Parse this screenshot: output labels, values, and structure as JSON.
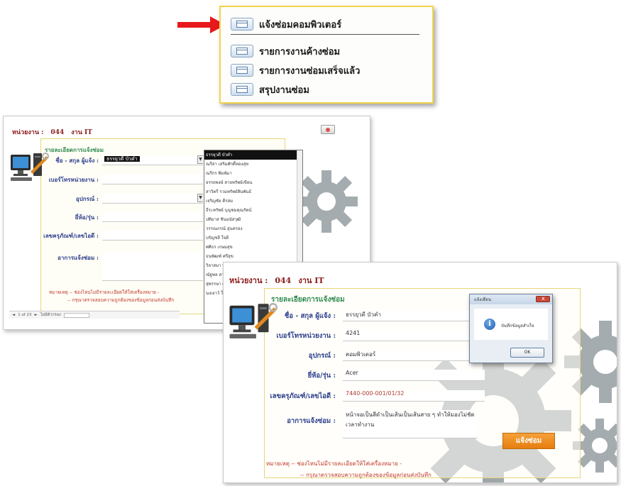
{
  "menu": {
    "items": [
      {
        "label": "แจ้งซ่อมคอมพิวเตอร์",
        "icon": "form-icon"
      },
      {
        "label": "รายการงานค้างซ่อม",
        "icon": "form-icon"
      },
      {
        "label": "รายการงานซ่อมเสร็จแล้ว",
        "icon": "form-icon"
      },
      {
        "label": "สรุปงานซ่อม",
        "icon": "form-icon"
      }
    ],
    "pointer_icon": "red-arrow-icon"
  },
  "form_a": {
    "dept_label": "หน่วยงาน :",
    "dept_code": "044",
    "dept_name": "งาน IT",
    "section_title": "รายละเอียดการแจ้งซ่อม",
    "labels": {
      "name": "ชื่อ - สกุล ผู้แจ้ง :",
      "phone": "เบอร์โทรหน่วยงาน :",
      "device": "อุปกรณ์ :",
      "brand": "ยี่ห้อ/รุ่น :",
      "asset_no": "เลขครุภัณฑ์/เลขไอดี :",
      "symptom": "อาการแจ้งซ่อม :"
    },
    "values": {
      "name": "ธรรยุวดี บัวคำ",
      "phone": "",
      "device": "",
      "brand": "",
      "asset_no": "",
      "symptom": ""
    },
    "dropdown_options": [
      "ธรรยุวดี บัวคำ",
      "ณรีสา เสริมศักดิ์ทองสุข",
      "ณรีกร พิมพ์มา",
      "อรรถพงษ์ สายทรัพย์เขียน",
      "สาวิตรี รวมทรัพย์สินพันธ์",
      "เจริญชัย ดีรสม",
      "ธีระทรัพย์ บุญชมคุณรัตน์",
      "ปทิมาส ชินมนัสวุฒิ",
      "วรรณภรณ์ อุ่นครอง",
      "บรัญชลี ใจดี",
      "ศศิธร เกษมสุข",
      "ธนพัฒฑ์ ศรีสุข",
      "วิลาสมา นันทวงค์",
      "ณัฐพล สายทอง",
      "สุพรรษา ศรีแก้ว",
      "นงเยาว์ ใจดี"
    ],
    "note1": "หมายเหตุ -- ช่องไหนไม่มีรายละเอียดให้ใส่เครื่องหมาย -",
    "note2": "-- กรุณาตรวจสอบความถูกต้องของข้อมูลก่อนส่งบันทึก",
    "nav": {
      "record": "1 of 23",
      "filter": "ไม่มีตัวกรอง",
      "search": "ค้นหา"
    }
  },
  "form_b": {
    "dept_label": "หน่วยงาน :",
    "dept_code": "044",
    "dept_name": "งาน IT",
    "section_title": "รายละเอียดการแจ้งซ่อม",
    "labels": {
      "name": "ชื่อ - สกุล ผู้แจ้ง :",
      "phone": "เบอร์โทรหน่วยงาน :",
      "device": "อุปกรณ์ :",
      "brand": "ยี่ห้อ/รุ่น :",
      "asset_no": "เลขครุภัณฑ์/เลขไอดี :",
      "symptom": "อาการแจ้งซ่อม :"
    },
    "values": {
      "name": "ธรรยุวดี บัวคำ",
      "phone": "4241",
      "device": "คอมพิวเตอร์",
      "brand": "Acer",
      "asset_no": "7440-000-001/01/32",
      "symptom": "หน้าจอเป็นสีดำเป็นเส้นเป็นเส้นสาย ๆ ทำให้มองไม่ชัดเวลาทำงาน"
    },
    "submit_label": "แจ้งซ่อม",
    "note1": "หมายเหตุ -- ช่องไหนไม่มีรายละเอียดให้ใส่เครื่องหมาย -",
    "note2": "-- กรุณาตรวจสอบความถูกต้องของข้อมูลก่อนส่งบันทึก"
  },
  "dialog": {
    "title": "แจ้งเตือน",
    "message": "บันทึกข้อมูลสำเร็จ",
    "ok_label": "OK",
    "icon": "info-icon"
  },
  "colors": {
    "menu_border": "#f3d44a",
    "arrow": "#e8191c",
    "dept_text": "#8b1a1a",
    "section_title": "#2f8b50",
    "field_label": "#2c3e8c",
    "note_text": "#c0392b",
    "submit_button": "#e67e0f",
    "gear": "#8e989c"
  }
}
